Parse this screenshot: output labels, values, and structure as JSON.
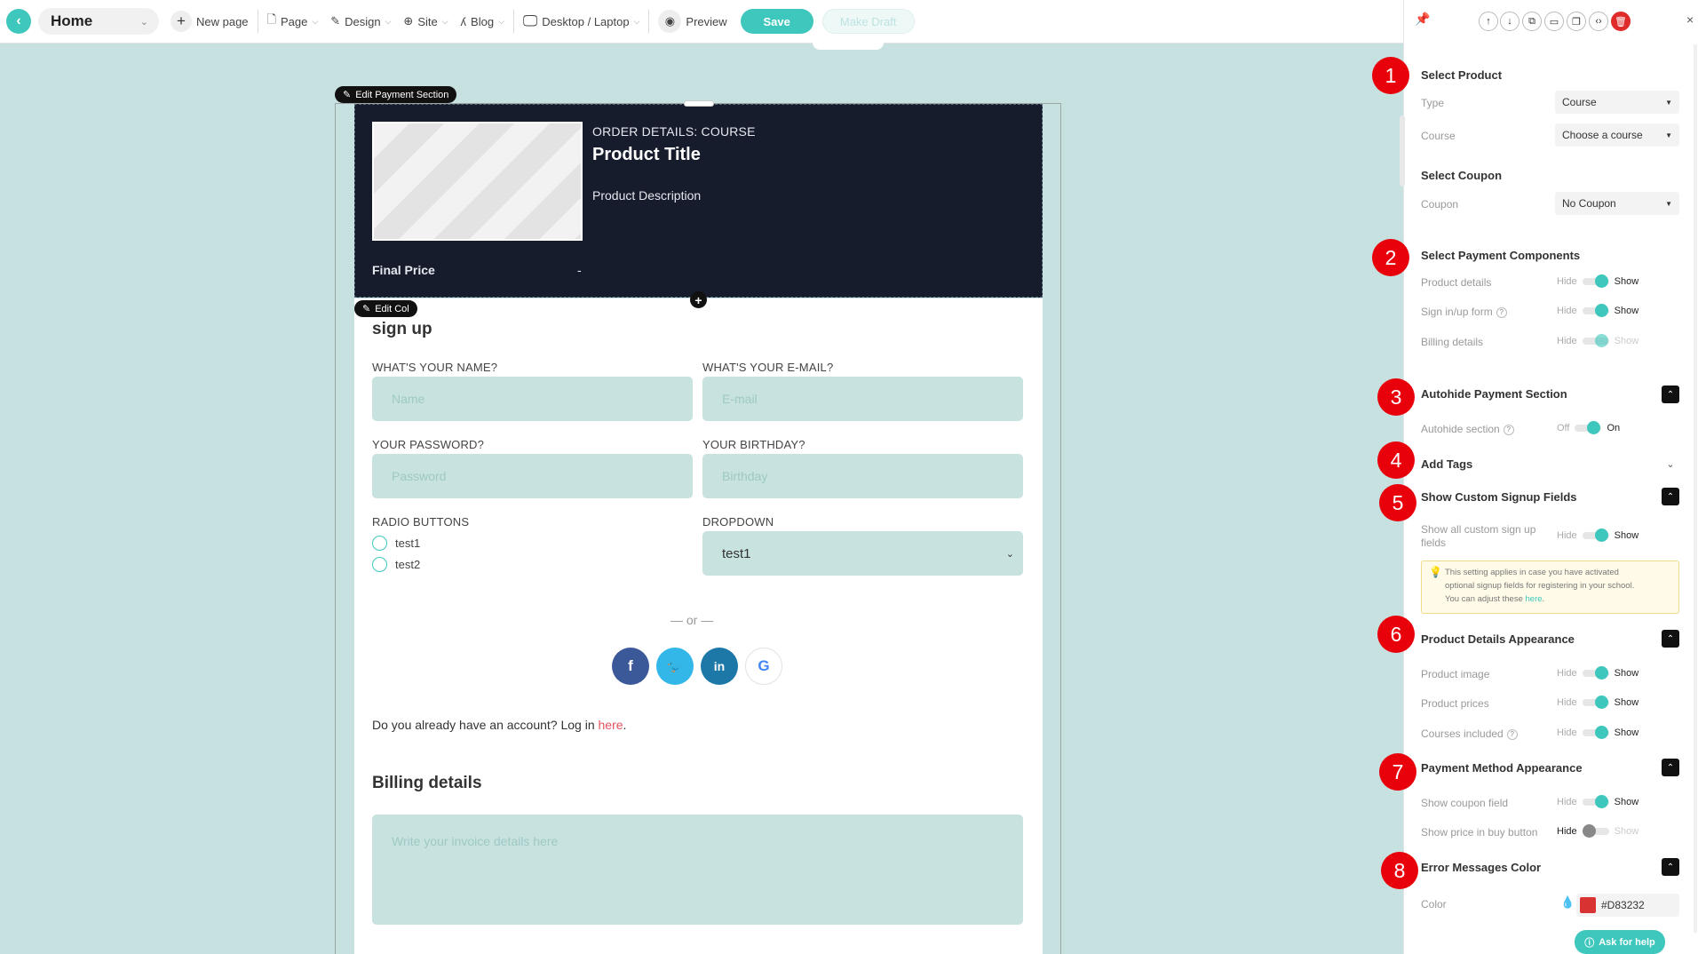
{
  "toolbar": {
    "page_name": "Home",
    "new_page": "New page",
    "page": "Page",
    "design": "Design",
    "site": "Site",
    "blog": "Blog",
    "device": "Desktop / Laptop",
    "preview": "Preview",
    "save": "Save",
    "make_draft": "Make Draft"
  },
  "canvas": {
    "edit_payment_section": "Edit Payment Section",
    "edit_col": "Edit Col",
    "order": {
      "heading": "ORDER DETAILS: COURSE",
      "title": "Product Title",
      "description": "Product Description",
      "final_price_label": "Final Price",
      "final_price_value": "-"
    },
    "signup": {
      "heading": "sign up",
      "name_label": "WHAT'S YOUR NAME?",
      "name_placeholder": "Name",
      "email_label": "WHAT'S YOUR E-MAIL?",
      "email_placeholder": "E-mail",
      "password_label": "YOUR PASSWORD?",
      "password_placeholder": "Password",
      "birthday_label": "YOUR BIRTHDAY?",
      "birthday_placeholder": "Birthday",
      "radio_label": "RADIO BUTTONS",
      "radio_options": [
        "test1",
        "test2"
      ],
      "dropdown_label": "DROPDOWN",
      "dropdown_value": "test1",
      "or": "— or —",
      "account_text": "Do you already have an account? Log in",
      "account_link": "here",
      "account_end": "."
    },
    "billing": {
      "heading": "Billing details",
      "placeholder": "Write your invoice details here"
    }
  },
  "panel": {
    "select_product": "Select Product",
    "type_label": "Type",
    "type_value": "Course",
    "course_label": "Course",
    "course_value": "Choose a course",
    "select_coupon": "Select Coupon",
    "coupon_label": "Coupon",
    "coupon_value": "No Coupon",
    "select_payment_components": "Select Payment Components",
    "product_details": "Product details",
    "sign_form": "Sign in/up form",
    "billing_details": "Billing details",
    "autohide_payment_section": "Autohide Payment Section",
    "autohide_section": "Autohide section",
    "add_tags": "Add Tags",
    "show_custom_signup_fields": "Show Custom Signup Fields",
    "show_all_custom_line1": "Show all custom sign up",
    "show_all_custom_line2": "fields",
    "note_line1": "This setting applies in case you have activated",
    "note_line2": "optional signup fields for registering in your school.",
    "note_line3": "You can adjust these",
    "note_link": "here",
    "note_end": ".",
    "product_details_appearance": "Product Details Appearance",
    "product_image": "Product image",
    "product_prices": "Product prices",
    "courses_included": "Courses included",
    "payment_method_appearance": "Payment Method Appearance",
    "show_coupon_field": "Show coupon field",
    "show_price_in_buy_button": "Show price in buy button",
    "error_messages_color": "Error Messages Color",
    "color_label": "Color",
    "color_value": "#D83232",
    "ask_for_help": "Ask for help",
    "hide": "Hide",
    "show": "Show",
    "off": "Off",
    "on": "On",
    "q": "?"
  },
  "badges": [
    "1",
    "2",
    "3",
    "4",
    "5",
    "6",
    "7",
    "8"
  ],
  "colors": {
    "accent": "#3ec7bd",
    "order_bg": "#161c2b",
    "badge": "#e8000b",
    "error": "#d83232",
    "canvas_bg": "#c6e1df"
  }
}
